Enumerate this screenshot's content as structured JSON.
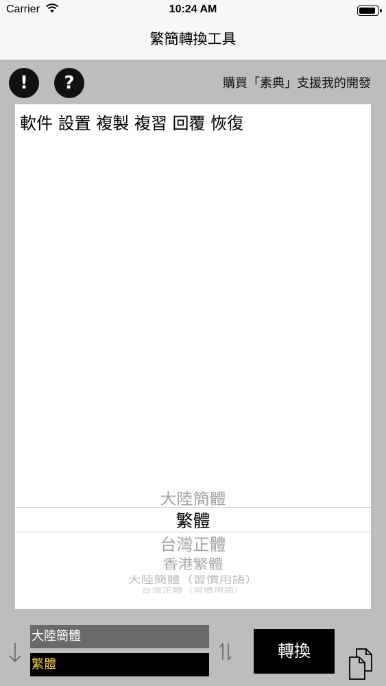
{
  "status_bar": {
    "carrier": "Carrier",
    "time": "10:24 AM",
    "battery_level": 0.9
  },
  "nav": {
    "title": "繁簡轉換工具"
  },
  "toolbar": {
    "info_glyph": "!",
    "help_glyph": "?",
    "promo_text": "購買「素典」支援我的開發"
  },
  "editor": {
    "text": "軟件 設置 複製 複習 回覆 恢復"
  },
  "picker": {
    "options": [
      "大陸簡體",
      "繁體",
      "台灣正體",
      "香港繁體",
      "大陸簡體（習慣用語）",
      "台灣正體（習慣用語）"
    ],
    "selected_index": 1
  },
  "conversion": {
    "source": "大陸簡體",
    "target": "繁體",
    "convert_label": "轉換"
  },
  "icons": {
    "wifi": "wifi-icon",
    "down_arrow": "arrow-down-icon",
    "swap": "swap-arrows-icon",
    "copy": "copy-icon"
  },
  "colors": {
    "target_text": "#f3c84b",
    "background": "#bdbdbd"
  }
}
